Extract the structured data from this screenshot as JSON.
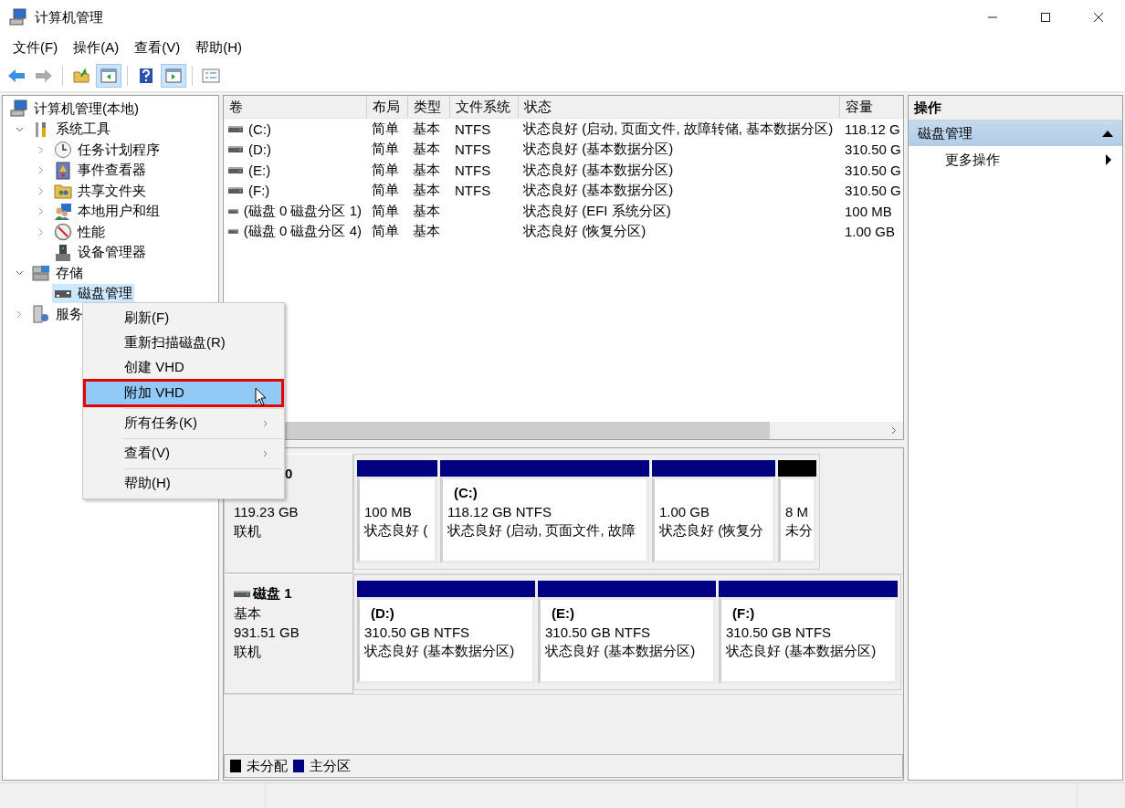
{
  "window": {
    "title": "计算机管理"
  },
  "menu": [
    "文件(F)",
    "操作(A)",
    "查看(V)",
    "帮助(H)"
  ],
  "toolbar": [
    {
      "kind": "back",
      "disabled": false,
      "pressed": false
    },
    {
      "kind": "forward",
      "disabled": true,
      "pressed": false
    },
    {
      "kind": "up",
      "disabled": false,
      "pressed": false
    },
    {
      "kind": "tree",
      "disabled": false,
      "pressed": true
    },
    {
      "kind": "help",
      "disabled": false,
      "pressed": false
    },
    {
      "kind": "actions",
      "disabled": false,
      "pressed": true
    },
    {
      "kind": "properties",
      "disabled": false,
      "pressed": false
    }
  ],
  "tree": {
    "label": "计算机管理(本地)",
    "selected": false,
    "children": [
      {
        "label": "系统工具",
        "expanded": true,
        "selected": false,
        "children": [
          {
            "label": "任务计划程序",
            "expanded": false,
            "selected": false
          },
          {
            "label": "事件查看器",
            "expanded": false,
            "selected": false
          },
          {
            "label": "共享文件夹",
            "expanded": false,
            "selected": false
          },
          {
            "label": "本地用户和组",
            "expanded": false,
            "selected": false
          },
          {
            "label": "性能",
            "expanded": false,
            "selected": false
          },
          {
            "label": "设备管理器",
            "selected": false
          }
        ]
      },
      {
        "label": "存储",
        "expanded": true,
        "selected": false,
        "children": [
          {
            "label": "磁盘管理",
            "selected": true
          }
        ]
      },
      {
        "label": "服务",
        "expanded": false,
        "selected": false
      }
    ]
  },
  "table": {
    "columns": [
      "卷",
      "布局",
      "类型",
      "文件系统",
      "状态",
      "容量"
    ],
    "rows": [
      {
        "volume": "(C:)",
        "layout": "简单",
        "type": "基本",
        "filesystem": "NTFS",
        "status": "状态良好 (启动, 页面文件, 故障转储, 基本数据分区)",
        "capacity": "118.12 G"
      },
      {
        "volume": "(D:)",
        "layout": "简单",
        "type": "基本",
        "filesystem": "NTFS",
        "status": "状态良好 (基本数据分区)",
        "capacity": "310.50 G"
      },
      {
        "volume": "(E:)",
        "layout": "简单",
        "type": "基本",
        "filesystem": "NTFS",
        "status": "状态良好 (基本数据分区)",
        "capacity": "310.50 G"
      },
      {
        "volume": "(F:)",
        "layout": "简单",
        "type": "基本",
        "filesystem": "NTFS",
        "status": "状态良好 (基本数据分区)",
        "capacity": "310.50 G"
      },
      {
        "volume": "(磁盘 0 磁盘分区 1)",
        "layout": "简单",
        "type": "基本",
        "status": "状态良好 (EFI 系统分区)",
        "capacity": "100 MB"
      },
      {
        "volume": "(磁盘 0 磁盘分区 4)",
        "layout": "简单",
        "type": "基本",
        "status": "状态良好 (恢复分区)",
        "capacity": "1.00 GB"
      }
    ]
  },
  "disks": [
    {
      "name": "0",
      "size": "119.23 GB",
      "status": "联机",
      "partitions": [
        {
          "kind": "primary",
          "size": "100 MB",
          "status": "状态良好 ("
        },
        {
          "kind": "primary",
          "name": "(C:)",
          "size": "118.12 GB NTFS",
          "status": "状态良好 (启动, 页面文件, 故障"
        },
        {
          "kind": "primary",
          "size": "1.00 GB",
          "status": "状态良好 (恢复分"
        },
        {
          "kind": "unallocated",
          "size": "8 M",
          "status": "未分"
        }
      ]
    },
    {
      "name": "磁盘 1",
      "type": "基本",
      "size": "931.51 GB",
      "status": "联机",
      "partitions": [
        {
          "kind": "primary",
          "name": "(D:)",
          "size": "310.50 GB NTFS",
          "status": "状态良好 (基本数据分区)"
        },
        {
          "kind": "primary",
          "name": "(E:)",
          "size": "310.50 GB NTFS",
          "status": "状态良好 (基本数据分区)"
        },
        {
          "kind": "primary",
          "name": "(F:)",
          "size": "310.50 GB NTFS",
          "status": "状态良好 (基本数据分区)"
        }
      ]
    }
  ],
  "legend": [
    {
      "label": "未分配",
      "color": "#000000"
    },
    {
      "label": "主分区",
      "color": "#000080"
    }
  ],
  "actions": {
    "title": "操作",
    "sections": [
      {
        "label": "磁盘管理",
        "expanded": true,
        "items": [
          {
            "label": "更多操作",
            "submenu": true
          }
        ]
      }
    ]
  },
  "context_menu": {
    "items": [
      {
        "kind": "item",
        "label": "刷新(F)",
        "submenu": false,
        "selected": false
      },
      {
        "kind": "item",
        "label": "重新扫描磁盘(R)",
        "submenu": false,
        "selected": false
      },
      {
        "kind": "item",
        "label": "创建 VHD",
        "submenu": false,
        "selected": false
      },
      {
        "kind": "item",
        "label": "附加 VHD",
        "submenu": false,
        "selected": true
      },
      {
        "kind": "separator"
      },
      {
        "kind": "item",
        "label": "所有任务(K)",
        "submenu": true,
        "selected": false
      },
      {
        "kind": "separator"
      },
      {
        "kind": "item",
        "label": "查看(V)",
        "submenu": true,
        "selected": false
      },
      {
        "kind": "separator"
      },
      {
        "kind": "item",
        "label": "帮助(H)",
        "submenu": false,
        "selected": false
      }
    ]
  }
}
